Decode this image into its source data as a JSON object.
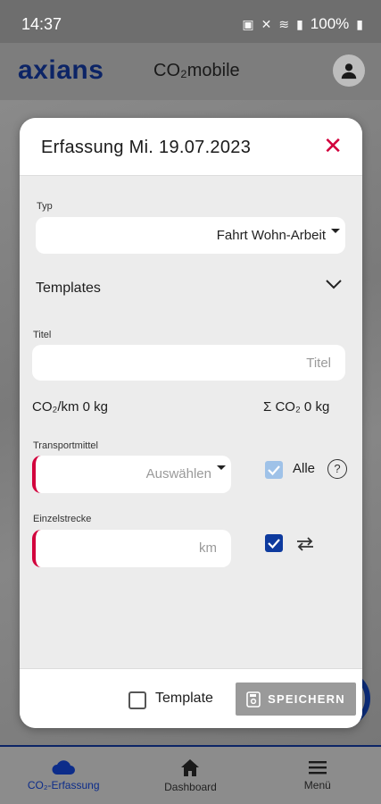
{
  "statusbar": {
    "time": "14:37",
    "battery": "100%"
  },
  "header": {
    "logo": "axians",
    "title": "CO₂mobile"
  },
  "modal": {
    "title": "Erfassung Mi. 19.07.2023",
    "typ": {
      "label": "Typ",
      "value": "Fahrt Wohn-Arbeit"
    },
    "templates": {
      "label": "Templates"
    },
    "titel": {
      "label": "Titel",
      "placeholder": "Titel"
    },
    "co2_per_km": "CO₂/km 0 kg",
    "co2_sum": "Σ CO₂ 0 kg",
    "transportmittel": {
      "label": "Transportmittel",
      "placeholder": "Auswählen"
    },
    "alle": {
      "label": "Alle",
      "checked": true,
      "disabled": true
    },
    "einzelstrecke": {
      "label": "Einzelstrecke",
      "placeholder": "km"
    },
    "roundtrip": {
      "checked": true
    },
    "footer": {
      "template_label": "Template",
      "template_checked": false,
      "save_label": "SPEICHERN"
    }
  },
  "bottomnav": {
    "items": [
      {
        "label": "CO₂-Erfassung",
        "icon": "cloud-icon",
        "active": true
      },
      {
        "label": "Dashboard",
        "icon": "home-icon",
        "active": false
      },
      {
        "label": "Menü",
        "icon": "menu-icon",
        "active": false
      }
    ]
  },
  "colors": {
    "accent": "#d2003c",
    "brand": "#0c2466",
    "checkbox": "#0d3a9e"
  }
}
